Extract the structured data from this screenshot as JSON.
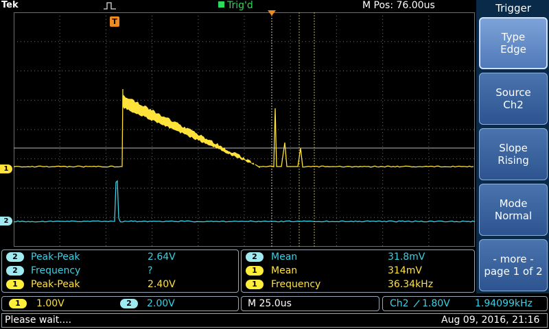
{
  "header": {
    "brand": "Tek",
    "trigger_state": "Trig'd",
    "position_label": "M Pos: 76.00us"
  },
  "markers": {
    "trigger_pos": "T",
    "ch1_ref": "1",
    "ch2_ref": "2"
  },
  "menu": {
    "title": "Trigger",
    "items": [
      {
        "line1": "Type",
        "line2": "Edge"
      },
      {
        "line1": "Source",
        "line2": "Ch2"
      },
      {
        "line1": "Slope",
        "line2": "Rising"
      },
      {
        "line1": "Mode",
        "line2": "Normal"
      },
      {
        "line1": "- more -",
        "line2": "page 1 of 2"
      }
    ]
  },
  "measurements": {
    "left": [
      {
        "channel": "2",
        "name": "Peak-Peak",
        "value": "2.64V"
      },
      {
        "channel": "2",
        "name": "Frequency",
        "value": "?"
      },
      {
        "channel": "1",
        "name": "Peak-Peak",
        "value": "2.40V"
      }
    ],
    "right": [
      {
        "channel": "2",
        "name": "Mean",
        "value": "31.8mV"
      },
      {
        "channel": "1",
        "name": "Mean",
        "value": "314mV"
      },
      {
        "channel": "1",
        "name": "Frequency",
        "value": "36.34kHz"
      }
    ]
  },
  "settings": {
    "ch1_channel": "1",
    "ch1_scale": "1.00V",
    "ch2_channel": "2",
    "ch2_scale": "2.00V",
    "timebase": "M 25.0us",
    "trigger_source": "Ch2",
    "trigger_slope_icon": "rising-edge-icon",
    "trigger_level": "1.80V",
    "trigger_frequency": "1.94099kHz"
  },
  "status": {
    "message": "Please wait....",
    "datetime": "Aug 09, 2016, 21:16"
  },
  "colors": {
    "ch1": "#ffe23a",
    "ch2": "#39d2e6",
    "grid": "#6e6e6e",
    "trigd": "#2fd75a",
    "trigger_marker": "#f08a1e"
  }
}
